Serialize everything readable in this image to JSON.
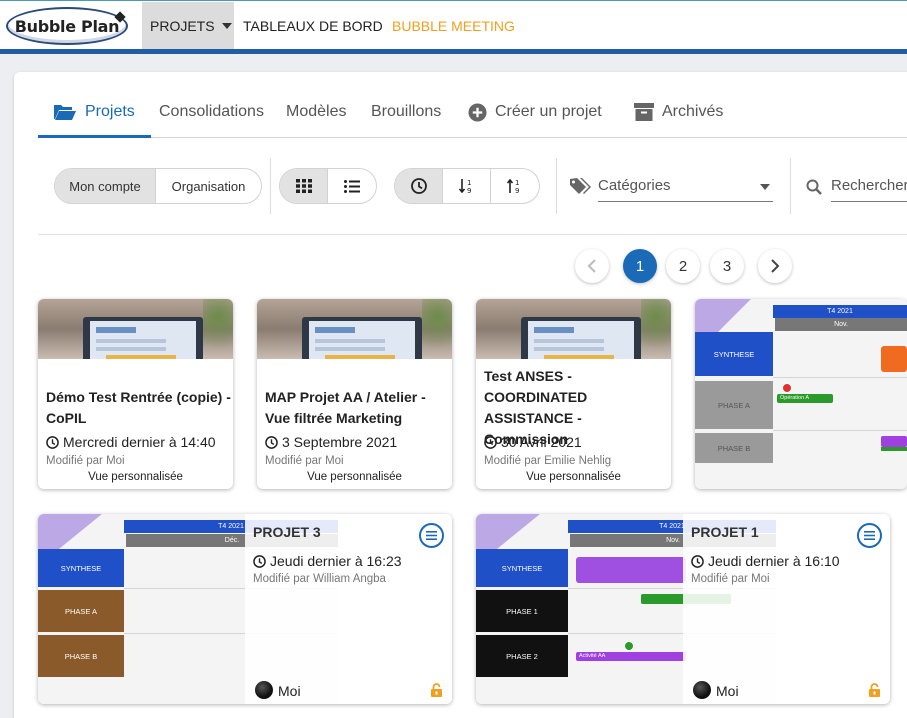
{
  "topnav": {
    "logo": "Bubble Plan",
    "projets": "PROJETS",
    "tableaux": "TABLEAUX DE BORD",
    "meeting": "BUBBLE MEETING"
  },
  "tabs": {
    "projets": "Projets",
    "consolidations": "Consolidations",
    "modeles": "Modèles",
    "brouillons": "Brouillons",
    "creer": "Créer un projet",
    "archives": "Archivés"
  },
  "toolbar": {
    "mon_compte": "Mon compte",
    "organisation": "Organisation",
    "categories": "Catégories",
    "search_placeholder": "Rechercher"
  },
  "pagination": {
    "pages": [
      "1",
      "2",
      "3"
    ],
    "current": "1"
  },
  "cards": [
    {
      "title": "Démo Test Rentrée (copie) - CoPIL",
      "date": "Mercredi dernier à 14:40",
      "modified": "Modifié par Moi",
      "view": "Vue personnalisée"
    },
    {
      "title": "MAP Projet AA / Atelier - Vue filtrée Marketing",
      "date": "3 Septembre 2021",
      "modified": "Modifié par Moi",
      "view": "Vue personnalisée"
    },
    {
      "title": "Test ANSES - COORDINATED ASSISTANCE - Commission",
      "date": "30 Avril 2021",
      "modified": "Modifié par Emilie Nehlig",
      "view": "Vue personnalisée"
    },
    {
      "gantt": {
        "period": "T4 2021",
        "month": "Nov.",
        "rows": [
          "SYNTHESE",
          "PHASE A",
          "PHASE B"
        ],
        "bar": "Opération A"
      }
    },
    {
      "title": "PROJET 3",
      "date": "Jeudi dernier à 16:23",
      "modified": "Modifié par William Angba",
      "owner": "Moi",
      "gantt": {
        "period": "T4 2021",
        "month": "Déc.",
        "rows": [
          "SYNTHESE",
          "PHASE A",
          "PHASE B"
        ]
      }
    },
    {
      "title": "PROJET 1",
      "date": "Jeudi dernier à 16:10",
      "modified": "Modifié par Moi",
      "owner": "Moi",
      "gantt": {
        "period": "T4 2021",
        "month": "Nov.",
        "rows": [
          "SYNTHESE",
          "PHASE 1",
          "PHASE 2"
        ],
        "bar": "Activité AA"
      }
    }
  ],
  "colors": {
    "accent": "#1a6ab8",
    "meeting": "#f0a020",
    "synthese": "#2050c8",
    "phase_brown": "#8a5a2a",
    "bar_green": "#2a9a2a",
    "bar_purple": "#a040e0",
    "lock": "#f0a020"
  }
}
